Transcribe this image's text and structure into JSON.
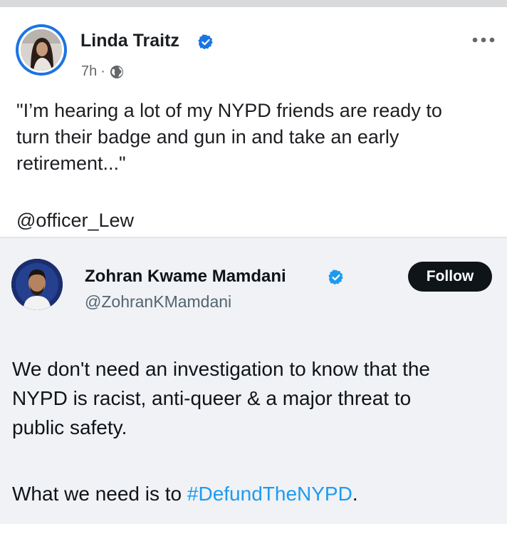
{
  "post": {
    "author": "Linda Traitz",
    "time": "7h",
    "separator": "·",
    "text_lines": [
      "\"I’m hearing a lot of my NYPD friends are ready to",
      "turn their badge and gun in and take an early",
      "retirement...\""
    ],
    "mention": "@officer_Lew"
  },
  "tweet": {
    "name": "Zohran Kwame Mamdani",
    "handle": "@ZohranKMamdani",
    "follow_label": "Follow",
    "text_lines": [
      "We don't need an investigation to know that the",
      "NYPD is racist, anti-queer & a major threat to",
      "public safety."
    ],
    "closing_prefix": "What we need is to ",
    "hashtag": "#DefundTheNYPD",
    "closing_suffix": "."
  },
  "icons": {
    "verified": "verified-badge-icon",
    "globe": "globe-icon",
    "more": "more-options-icon"
  },
  "colors": {
    "facebook_blue": "#1b74e4",
    "twitter_blue": "#1d9bf0",
    "tweet_bg": "#f0f2f5",
    "follow_bg": "#0f1419"
  }
}
